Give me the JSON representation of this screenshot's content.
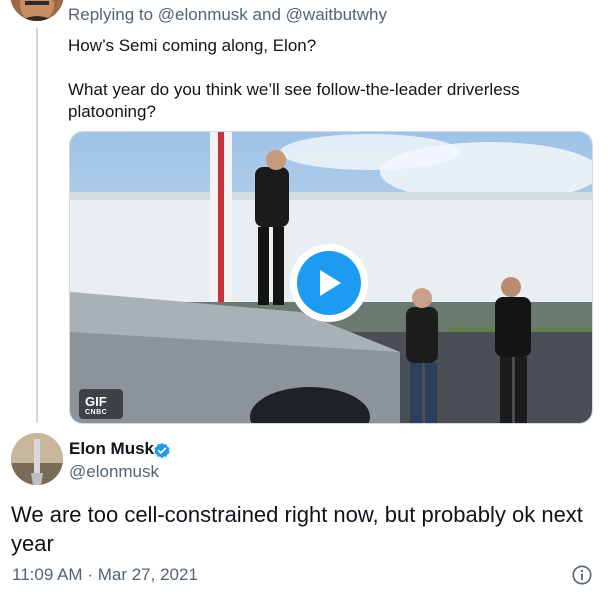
{
  "reply_context": {
    "prefix": "Replying to",
    "mention_1": "@elonmusk",
    "conjunction": "and",
    "mention_2": "@waitbutwhy"
  },
  "first_tweet": {
    "paragraph_1": "How’s Semi coming along, Elon?",
    "paragraph_2": "What year do you think we’ll see follow-the-leader driverless platooning?"
  },
  "media": {
    "badge": "GIF",
    "source": "CNBC"
  },
  "second_tweet": {
    "display_name": "Elon Musk",
    "handle": "@elonmusk",
    "text": "We are too cell-constrained right now, but probably ok next year",
    "time": "11:09 AM",
    "separator": "·",
    "date": "Mar 27, 2021"
  },
  "colors": {
    "accent": "#1d9bf0",
    "text_primary": "#0f1419",
    "text_secondary": "#536471",
    "thread_line": "#cfd9de"
  },
  "icons": {
    "play": "play-icon",
    "verified": "verified-badge-icon",
    "info": "info-icon"
  }
}
